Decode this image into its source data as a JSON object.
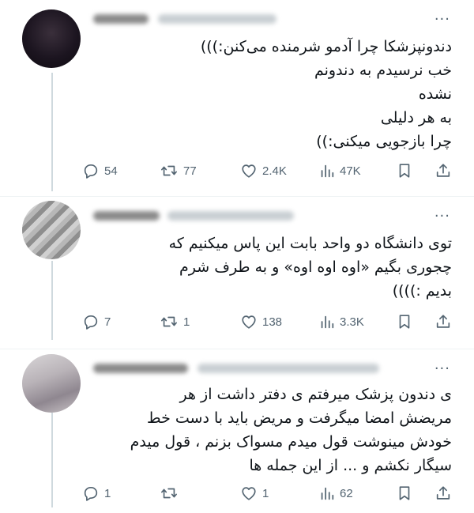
{
  "tweets": [
    {
      "more": "···",
      "lines": [
        "دندونپزشکا چرا آدمو شرمنده می‌کنن:)))",
        "خب نرسیدم به دندونم",
        "نشده",
        "به هر دلیلی",
        "چرا بازجویی میکنی:))"
      ],
      "actions": {
        "replies": "54",
        "reposts": "77",
        "likes": "2.4K",
        "views": "47K"
      }
    },
    {
      "more": "···",
      "lines": [
        "توی دانشگاه دو واحد بابت این پاس میکنیم که",
        "چجوری بگیم «اوه اوه اوه» و به طرف شرم",
        "بدیم :))))"
      ],
      "actions": {
        "replies": "7",
        "reposts": "1",
        "likes": "138",
        "views": "3.3K"
      }
    },
    {
      "more": "···",
      "lines": [
        "ی دندون پزشک میرفتم ی دفتر داشت از هر",
        "مریضش امضا میگرفت و مریض باید با دست خط",
        "خودش مینوشت قول میدم مسواک بزنم ، قول میدم",
        "سیگار نکشم و ... از این جمله ها"
      ],
      "actions": {
        "replies": "1",
        "reposts": "",
        "likes": "1",
        "views": "62"
      }
    }
  ]
}
